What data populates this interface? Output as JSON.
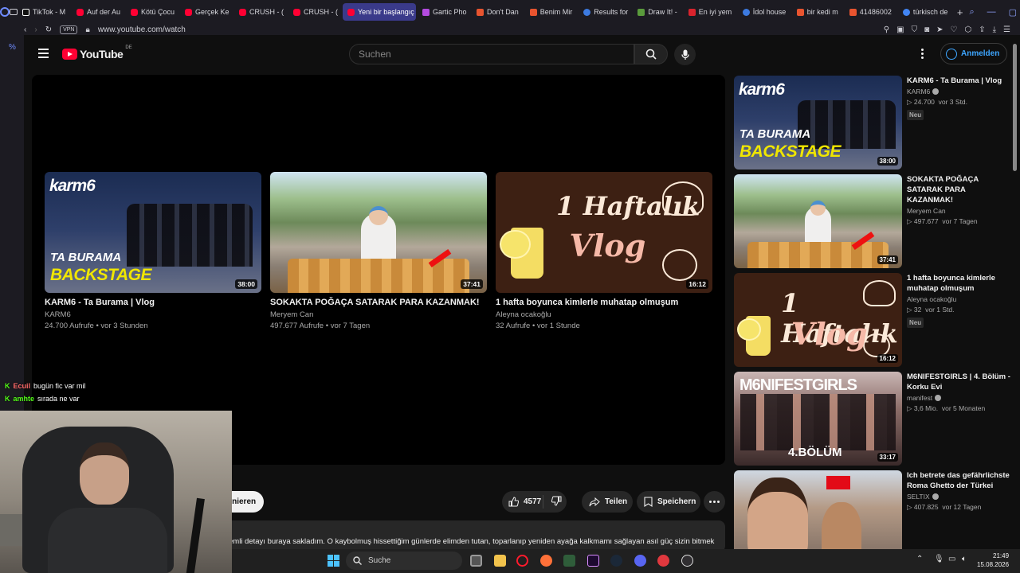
{
  "browser": {
    "tabs": [
      {
        "label": "TikTok - M",
        "favicon": "tiktok-icon",
        "active": false
      },
      {
        "label": "Auf der Au",
        "favicon": "youtube-icon",
        "active": false
      },
      {
        "label": "Kötü Çocu",
        "favicon": "youtube-icon",
        "active": false
      },
      {
        "label": "Gerçek Ke",
        "favicon": "youtube-icon",
        "active": false
      },
      {
        "label": "CRUSH - (",
        "favicon": "youtube-icon",
        "active": false
      },
      {
        "label": "CRUSH - (",
        "favicon": "youtube-icon",
        "active": false
      },
      {
        "label": "Yeni bir başlangıç",
        "favicon": "youtube-icon",
        "active": true
      },
      {
        "label": "Gartic Pho",
        "favicon": "phone-icon",
        "active": false
      },
      {
        "label": "Don't Dan",
        "favicon": "w-icon",
        "active": false
      },
      {
        "label": "Benim Mir",
        "favicon": "w-icon",
        "active": false
      },
      {
        "label": "Results for",
        "favicon": "globe-icon",
        "active": false
      },
      {
        "label": "Draw It! -",
        "favicon": "draw-icon",
        "active": false
      },
      {
        "label": "En iyi yem",
        "favicon": "u-icon",
        "active": false
      },
      {
        "label": "İdol house",
        "favicon": "cloud-icon",
        "active": false
      },
      {
        "label": "bir kedi m",
        "favicon": "w-icon",
        "active": false
      },
      {
        "label": "41486002",
        "favicon": "w-icon",
        "active": false
      },
      {
        "label": "türkisch de",
        "favicon": "google-icon",
        "active": false
      }
    ],
    "new_tab": "+",
    "vpn_label": "VPN",
    "url": "www.youtube.com/watch"
  },
  "youtube": {
    "logo_text": "YouTube",
    "country_code": "DE",
    "search_placeholder": "Suchen",
    "sign_in_label": "Anmelden"
  },
  "end_screen": [
    {
      "title": "KARM6 - Ta Burama | Vlog",
      "channel": "KARM6",
      "meta": "24.700 Aufrufe • vor 3 Stunden",
      "duration": "38:00",
      "art": "karm"
    },
    {
      "title": "SOKAKTA POĞAÇA SATARAK PARA KAZANMAK!",
      "channel": "Meryem Can",
      "meta": "497.677 Aufrufe • vor 7 Tagen",
      "duration": "37:41",
      "art": "street"
    },
    {
      "title": "1 hafta boyunca kimlerle muhatap olmuşum",
      "channel": "Aleyna ocakoğlu",
      "meta": "32 Aufrufe • vor 1 Stunde",
      "duration": "16:12",
      "art": "vlog"
    }
  ],
  "thumb_text": {
    "karm_brand": "karm6",
    "karm_line1": "TA BURAMA",
    "karm_line2": "BACKSTAGE",
    "vlog_line1": "1 Haftalık",
    "vlog_line2": "Vlog",
    "m6_title": "M6NIFESTGIRLS",
    "m6_badge": "4.BÖLÜM"
  },
  "actions": {
    "subscribe_partial": "nnieren",
    "like_count": "4577",
    "share_label": "Teilen",
    "save_label": "Speichern"
  },
  "description_snippet": "emli detayı buraya sakladım. O kaybolmuş hissettiğim günlerde elimden tutan, toparlanıp yeniden ayağa kalkmamı sağlayan asıl güç sizin bitmek",
  "recommendations": [
    {
      "title": "KARM6 - Ta Burama | Vlog",
      "channel": "KARM6",
      "verified": true,
      "views": "24.700",
      "age": "vor 3 Std.",
      "badge": "Neu",
      "duration": "38:00",
      "art": "karm"
    },
    {
      "title": "SOKAKTA POĞAÇA SATARAK PARA KAZANMAK!",
      "channel": "Meryem Can",
      "verified": false,
      "views": "497.677",
      "age": "vor 7 Tagen",
      "badge": "",
      "duration": "37:41",
      "art": "street"
    },
    {
      "title": "1 hafta boyunca kimlerle muhatap olmuşum",
      "channel": "Aleyna ocakoğlu",
      "verified": false,
      "views": "32",
      "age": "vor 1 Std.",
      "badge": "Neu",
      "duration": "16:12",
      "art": "vlog"
    },
    {
      "title": "M6NIFESTGIRLS | 4. Bölüm - Korku Evi",
      "channel": "manifest",
      "verified": true,
      "views": "3,6 Mio.",
      "age": "vor 5 Monaten",
      "badge": "",
      "duration": "33:17",
      "art": "m6"
    },
    {
      "title": "Ich betrete das gefährlichste Roma Ghetto der Türkei",
      "channel": "SELTIX",
      "verified": true,
      "views": "407.825",
      "age": "vor 12 Tagen",
      "badge": "",
      "duration": "",
      "art": "roma"
    }
  ],
  "stream_chat": [
    {
      "user": "Ecuil",
      "message": "bugün fic var mil"
    },
    {
      "user": "amhte",
      "message": "sırada ne var"
    }
  ],
  "taskbar": {
    "search_label": "Suche",
    "time": "21:49",
    "date": "15.08.2026"
  },
  "colors": {
    "youtube_red": "#ff0033",
    "background": "#0f0f0f",
    "link_blue": "#3ea6ff",
    "active_tab": "#3a3a8a"
  }
}
